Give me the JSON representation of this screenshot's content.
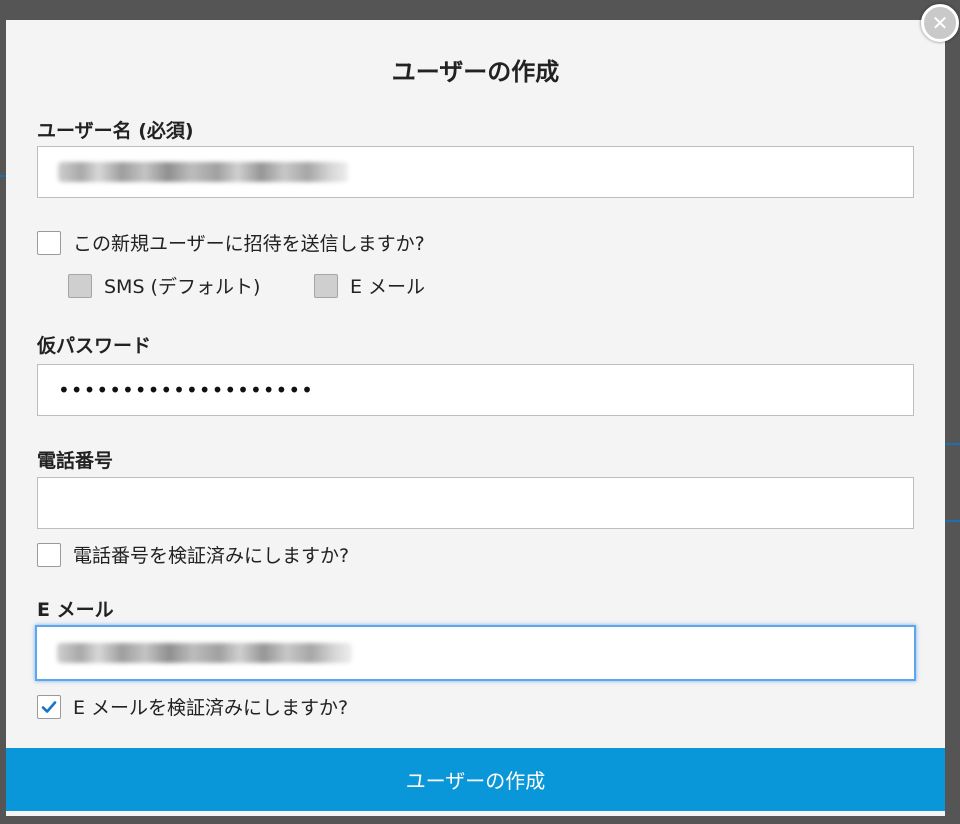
{
  "modal": {
    "title": "ユーザーの作成",
    "close_icon": "close-icon",
    "username": {
      "label": "ユーザー名 (必須)",
      "value": ""
    },
    "invite": {
      "label": "この新規ユーザーに招待を送信しますか?",
      "checked": false,
      "sms_label": "SMS (デフォルト)",
      "email_label": "E メール"
    },
    "temp_password": {
      "label": "仮パスワード",
      "value": "••••••••••••••••••••"
    },
    "phone": {
      "label": "電話番号",
      "value": "",
      "verify_label": "電話番号を検証済みにしますか?",
      "verify_checked": false
    },
    "email": {
      "label": "E メール",
      "value": "",
      "verify_label": "E メールを検証済みにしますか?",
      "verify_checked": true
    },
    "submit_label": "ユーザーの作成"
  },
  "colors": {
    "overlay": "#555555",
    "modal_bg": "#f4f4f4",
    "submit_bg": "#0a97d9",
    "focus_border": "#5ea6ec",
    "check_color": "#1a73c8"
  }
}
